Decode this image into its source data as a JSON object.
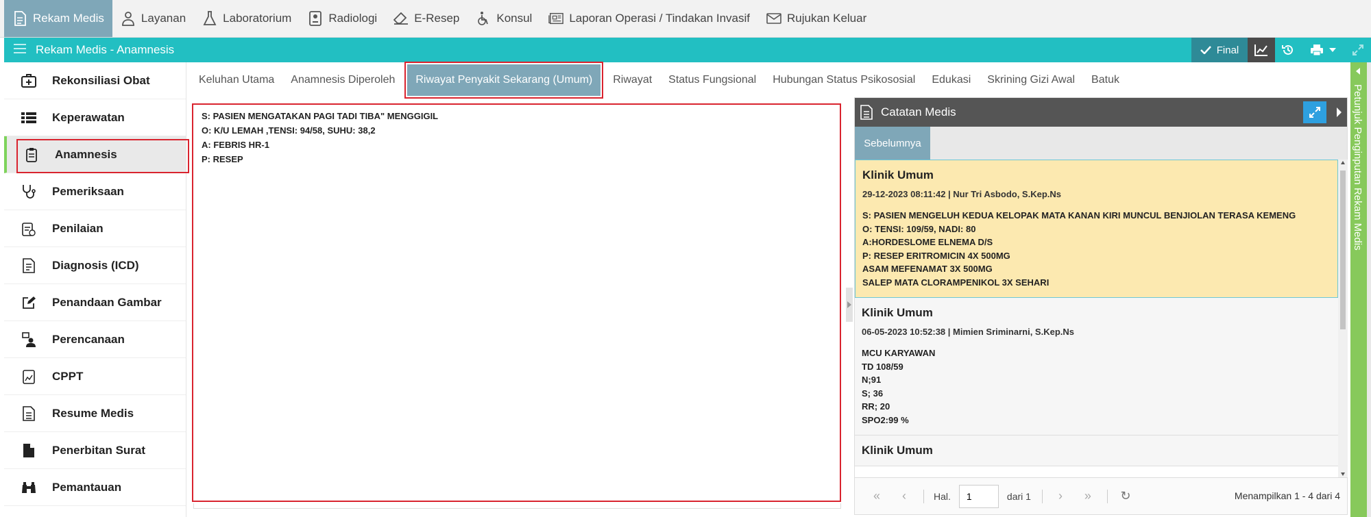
{
  "topnav": {
    "items": [
      {
        "label": "Rekam Medis",
        "icon": "document-icon",
        "active": true
      },
      {
        "label": "Layanan",
        "icon": "user-nurse-icon"
      },
      {
        "label": "Laboratorium",
        "icon": "flask-icon"
      },
      {
        "label": "Radiologi",
        "icon": "xray-icon"
      },
      {
        "label": "E-Resep",
        "icon": "eraser-icon"
      },
      {
        "label": "Konsul",
        "icon": "wheelchair-icon"
      },
      {
        "label": "Laporan Operasi / Tindakan Invasif",
        "icon": "newspaper-icon"
      },
      {
        "label": "Rujukan Keluar",
        "icon": "envelope-icon"
      }
    ]
  },
  "titlebar": {
    "title": "Rekam Medis - Anamnesis",
    "final_label": "Final"
  },
  "sidebar": {
    "items": [
      {
        "label": "Rekonsiliasi Obat",
        "icon": "medkit-icon"
      },
      {
        "label": "Keperawatan",
        "icon": "list-icon"
      },
      {
        "label": "Anamnesis",
        "icon": "clipboard-icon",
        "active": true
      },
      {
        "label": "Pemeriksaan",
        "icon": "stethoscope-icon"
      },
      {
        "label": "Penilaian",
        "icon": "checklist-icon"
      },
      {
        "label": "Diagnosis (ICD)",
        "icon": "file-code-icon"
      },
      {
        "label": "Penandaan Gambar",
        "icon": "edit-icon"
      },
      {
        "label": "Perencanaan",
        "icon": "user-plan-icon"
      },
      {
        "label": "CPPT",
        "icon": "chart-file-icon"
      },
      {
        "label": "Resume Medis",
        "icon": "file-text-icon"
      },
      {
        "label": "Penerbitan Surat",
        "icon": "file-icon"
      },
      {
        "label": "Pemantauan",
        "icon": "binoculars-icon"
      }
    ]
  },
  "tabs": [
    {
      "label": "Keluhan Utama"
    },
    {
      "label": "Anamnesis Diperoleh"
    },
    {
      "label": "Riwayat Penyakit Sekarang (Umum)",
      "active": true
    },
    {
      "label": "Riwayat"
    },
    {
      "label": "Status Fungsional"
    },
    {
      "label": "Hubungan Status Psikososial"
    },
    {
      "label": "Edukasi"
    },
    {
      "label": "Skrining Gizi Awal"
    },
    {
      "label": "Batuk"
    }
  ],
  "editor": {
    "lines": [
      "S: PASIEN MENGATAKAN PAGI TADI TIBA\" MENGGIGIL",
      "O: K/U LEMAH ,TENSI: 94/58, SUHU: 38,2",
      "A: FEBRIS HR-1",
      "P: RESEP"
    ]
  },
  "panel": {
    "title": "Catatan Medis",
    "subtab": "Sebelumnya",
    "notes": [
      {
        "title": "Klinik Umum",
        "meta": "29-12-2023 08:11:42 | Nur Tri Asbodo, S.Kep.Ns",
        "lines": [
          "S: PASIEN MENGELUH KEDUA KELOPAK MATA KANAN KIRI MUNCUL BENJIOLAN TERASA KEMENG",
          "O: TENSI: 109/59, NADI: 80",
          "A:HORDESLOME ELNEMA D/S",
          "P: RESEP ERITROMICIN 4X 500MG",
          "ASAM MEFENAMAT 3X 500MG",
          "SALEP MATA CLORAMPENIKOL 3X SEHARI"
        ]
      },
      {
        "title": "Klinik Umum",
        "meta": "06-05-2023 10:52:38 | Mimien Sriminarni, S.Kep.Ns",
        "lines": [
          "MCU KARYAWAN",
          "TD 108/59",
          "N;91",
          "S; 36",
          "RR; 20",
          "SPO2:99 %"
        ]
      },
      {
        "title": "Klinik Umum",
        "meta": "",
        "lines": []
      }
    ],
    "pager": {
      "hal_label": "Hal.",
      "page_value": "1",
      "of_label": "dari 1",
      "info": "Menampilkan 1 - 4 dari 4"
    }
  },
  "rightrail": {
    "label": "Petunjuk Penginputan Rekam Medis"
  }
}
